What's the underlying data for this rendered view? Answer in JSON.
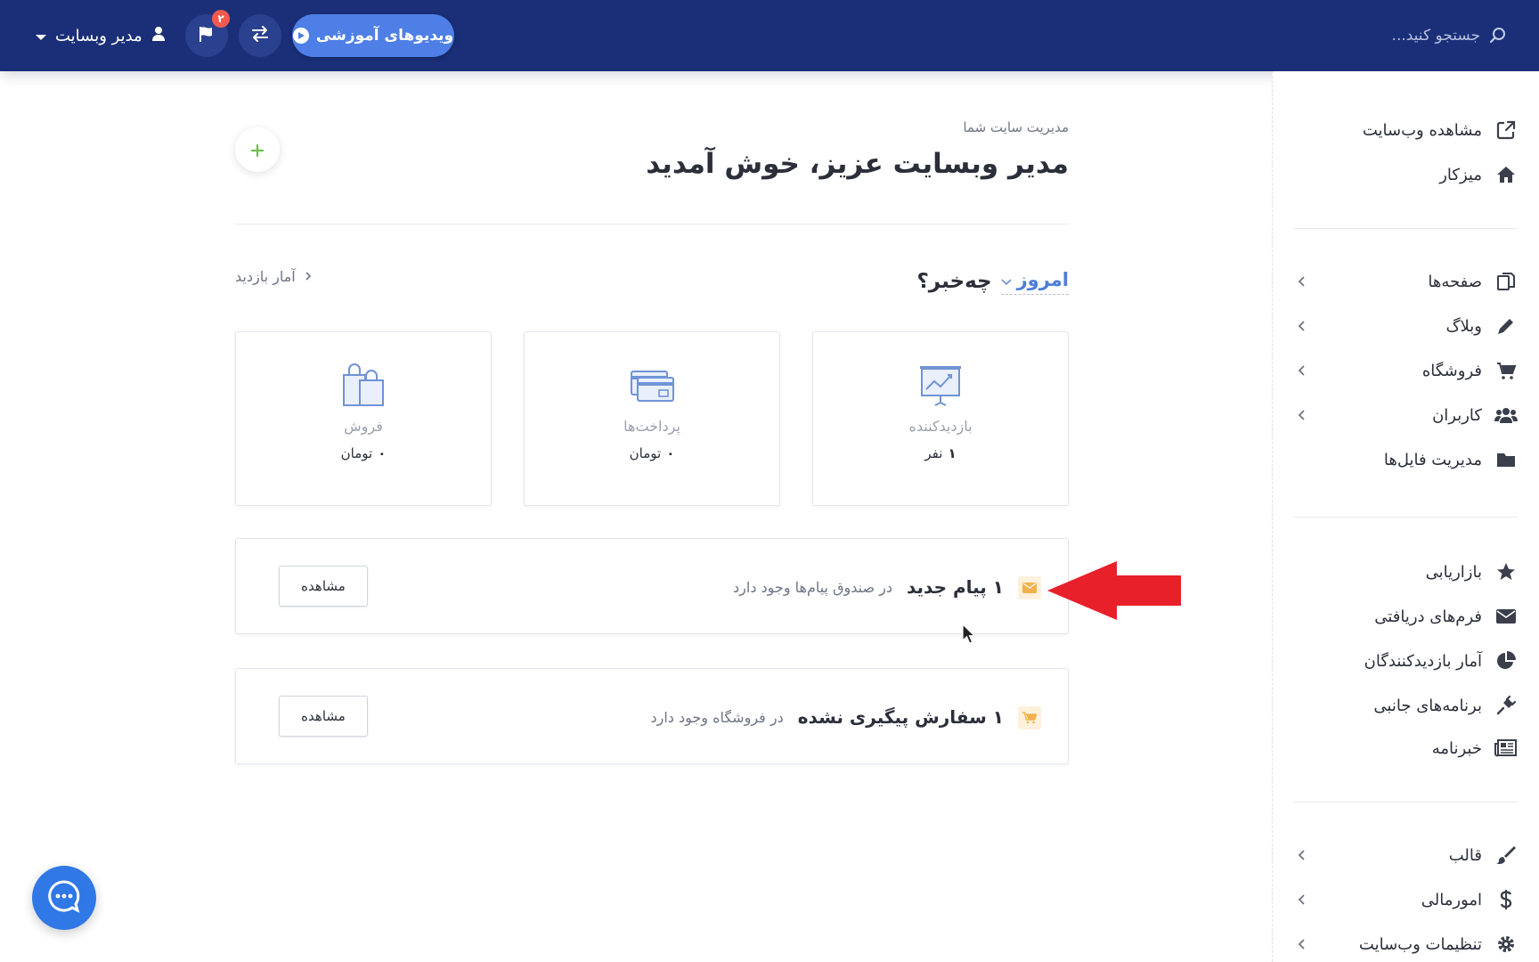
{
  "topbar": {
    "search_placeholder": "جستجو کنید...",
    "videos_button": "ویدیوهای آموزشی",
    "notifications_count": "۲",
    "user_name": "مدیر وبسایت"
  },
  "sidebar": {
    "group1": [
      {
        "label": "مشاهده وب‌سایت",
        "icon": "external-link-icon"
      },
      {
        "label": "میزکار",
        "icon": "home-icon"
      }
    ],
    "group2": [
      {
        "label": "صفحه‌ها",
        "icon": "pages-icon",
        "has_chevron": true
      },
      {
        "label": "وبلاگ",
        "icon": "pencil-icon",
        "has_chevron": true
      },
      {
        "label": "فروشگاه",
        "icon": "cart-icon",
        "has_chevron": true
      },
      {
        "label": "کاربران",
        "icon": "users-icon",
        "has_chevron": true
      },
      {
        "label": "مدیریت فایل‌ها",
        "icon": "folder-icon",
        "has_chevron": false
      }
    ],
    "group3": [
      {
        "label": "بازاریابی",
        "icon": "star-icon"
      },
      {
        "label": "فرم‌های دریافتی",
        "icon": "envelope-icon"
      },
      {
        "label": "آمار بازدیدکنندگان",
        "icon": "pie-chart-icon"
      },
      {
        "label": "برنامه‌های جانبی",
        "icon": "plug-icon"
      },
      {
        "label": "خبرنامه",
        "icon": "newspaper-icon"
      }
    ],
    "group4": [
      {
        "label": "قالب",
        "icon": "brush-icon",
        "has_chevron": true
      },
      {
        "label": "امورمالی",
        "icon": "dollar-icon",
        "has_chevron": true
      },
      {
        "label": "تنظیمات وب‌سایت",
        "icon": "gear-icon",
        "has_chevron": true
      }
    ]
  },
  "main": {
    "subtitle": "مدیریت سایت شما",
    "title": "مدیر وبسایت عزیز، خوش آمدید",
    "news_title": "چه‌خبر؟",
    "period": "امروز",
    "stats_link": "آمار بازدید",
    "cards": [
      {
        "label": "بازدیدکننده",
        "value": "۱",
        "unit": "نفر",
        "icon": "presentation-chart-icon"
      },
      {
        "label": "پرداخت‌ها",
        "value": "۰",
        "unit": "تومان",
        "icon": "credit-cards-icon"
      },
      {
        "label": "فروش",
        "value": "۰",
        "unit": "تومان",
        "icon": "shopping-bags-icon"
      }
    ],
    "notices": [
      {
        "bold": "۱ پیام جدید",
        "text": "در صندوق پیام‌ها وجود دارد",
        "button": "مشاهده",
        "icon": "envelope-icon"
      },
      {
        "bold": "۱ سفارش پیگیری نشده",
        "text": "در فروشگاه وجود دارد",
        "button": "مشاهده",
        "icon": "cart-icon"
      }
    ]
  },
  "colors": {
    "topbar": "#1a2f78",
    "accent": "#4e7fe6",
    "badge": "#f05a4f",
    "arrow": "#e8202a",
    "icon_blue": "#6f93d6"
  }
}
